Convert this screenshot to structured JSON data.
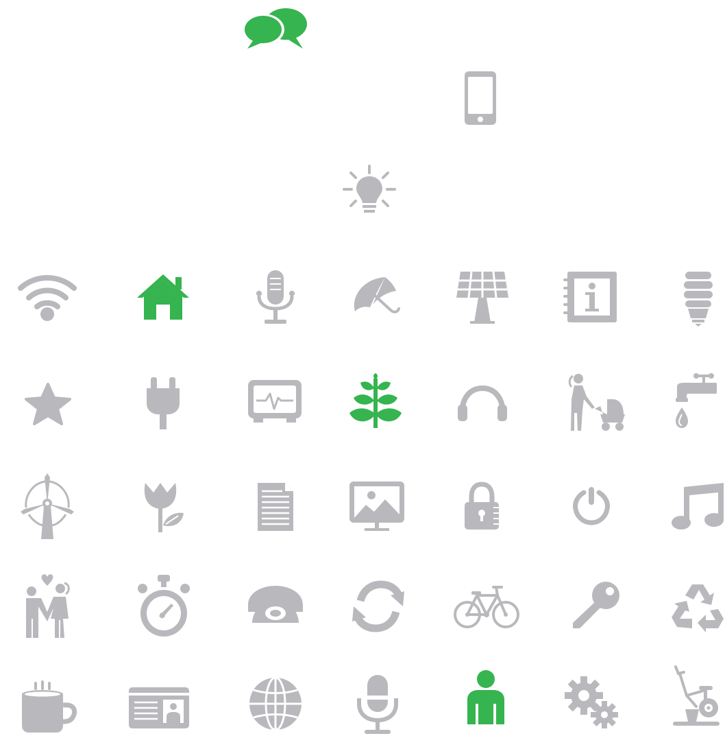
{
  "colors": {
    "gray": "#b9b9bd",
    "green": "#35b44f",
    "background": "#ffffff"
  },
  "icons": [
    {
      "id": "chat",
      "name": "chat-bubbles-icon",
      "color": "green"
    },
    {
      "id": "phone",
      "name": "smartphone-icon",
      "color": "gray"
    },
    {
      "id": "bulb",
      "name": "light-bulb-icon",
      "color": "gray"
    },
    {
      "id": "wifi",
      "name": "wifi-icon",
      "color": "gray"
    },
    {
      "id": "home",
      "name": "home-icon",
      "color": "green"
    },
    {
      "id": "mic1",
      "name": "studio-microphone-icon",
      "color": "gray"
    },
    {
      "id": "umbrella",
      "name": "umbrella-icon",
      "color": "gray"
    },
    {
      "id": "solar",
      "name": "solar-panel-icon",
      "color": "gray"
    },
    {
      "id": "info",
      "name": "info-notebook-icon",
      "color": "gray"
    },
    {
      "id": "cfl",
      "name": "energy-saving-bulb-icon",
      "color": "gray"
    },
    {
      "id": "star",
      "name": "star-icon",
      "color": "gray"
    },
    {
      "id": "plug",
      "name": "power-plug-icon",
      "color": "gray"
    },
    {
      "id": "monitor",
      "name": "heart-monitor-icon",
      "color": "gray"
    },
    {
      "id": "plant",
      "name": "plant-icon",
      "color": "green"
    },
    {
      "id": "headphones",
      "name": "headphones-icon",
      "color": "gray"
    },
    {
      "id": "stroller",
      "name": "mother-stroller-icon",
      "color": "gray"
    },
    {
      "id": "faucet",
      "name": "water-faucet-icon",
      "color": "gray"
    },
    {
      "id": "turbine",
      "name": "wind-turbine-icon",
      "color": "gray"
    },
    {
      "id": "tulip",
      "name": "tulip-icon",
      "color": "gray"
    },
    {
      "id": "document",
      "name": "document-icon",
      "color": "gray"
    },
    {
      "id": "picture",
      "name": "picture-monitor-icon",
      "color": "gray"
    },
    {
      "id": "lock",
      "name": "padlock-icon",
      "color": "gray"
    },
    {
      "id": "power",
      "name": "power-button-icon",
      "color": "gray"
    },
    {
      "id": "music",
      "name": "music-note-icon",
      "color": "gray"
    },
    {
      "id": "couple",
      "name": "couple-love-icon",
      "color": "gray"
    },
    {
      "id": "stopwatch",
      "name": "stopwatch-icon",
      "color": "gray"
    },
    {
      "id": "telephone",
      "name": "telephone-icon",
      "color": "gray"
    },
    {
      "id": "refresh",
      "name": "refresh-icon",
      "color": "gray"
    },
    {
      "id": "bicycle",
      "name": "bicycle-icon",
      "color": "gray"
    },
    {
      "id": "key",
      "name": "key-icon",
      "color": "gray"
    },
    {
      "id": "recycle",
      "name": "recycle-icon",
      "color": "gray"
    },
    {
      "id": "coffee",
      "name": "coffee-mug-icon",
      "color": "gray"
    },
    {
      "id": "idcard",
      "name": "id-card-icon",
      "color": "gray"
    },
    {
      "id": "globe",
      "name": "globe-icon",
      "color": "gray"
    },
    {
      "id": "mic2",
      "name": "microphone-icon",
      "color": "gray"
    },
    {
      "id": "person",
      "name": "person-icon",
      "color": "green"
    },
    {
      "id": "gears",
      "name": "gears-icon",
      "color": "gray"
    },
    {
      "id": "bike",
      "name": "exercise-bike-icon",
      "color": "gray"
    }
  ]
}
